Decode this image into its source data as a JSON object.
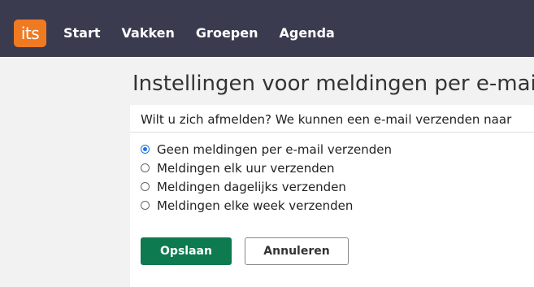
{
  "app": {
    "logo_text": "its",
    "brand_color": "#f07a22"
  },
  "nav": {
    "items": [
      {
        "label": "Start"
      },
      {
        "label": "Vakken"
      },
      {
        "label": "Groepen"
      },
      {
        "label": "Agenda"
      }
    ]
  },
  "page": {
    "title": "Instellingen voor meldingen per e-mail",
    "intro": "Wilt u zich afmelden? We kunnen een e-mail verzenden naar"
  },
  "form": {
    "options": [
      {
        "label": "Geen meldingen per e-mail verzenden",
        "checked": true
      },
      {
        "label": "Meldingen elk uur verzenden",
        "checked": false
      },
      {
        "label": "Meldingen dagelijks verzenden",
        "checked": false
      },
      {
        "label": "Meldingen elke week verzenden",
        "checked": false
      }
    ],
    "save_label": "Opslaan",
    "cancel_label": "Annuleren",
    "accent_color": "#0d7a4f"
  }
}
